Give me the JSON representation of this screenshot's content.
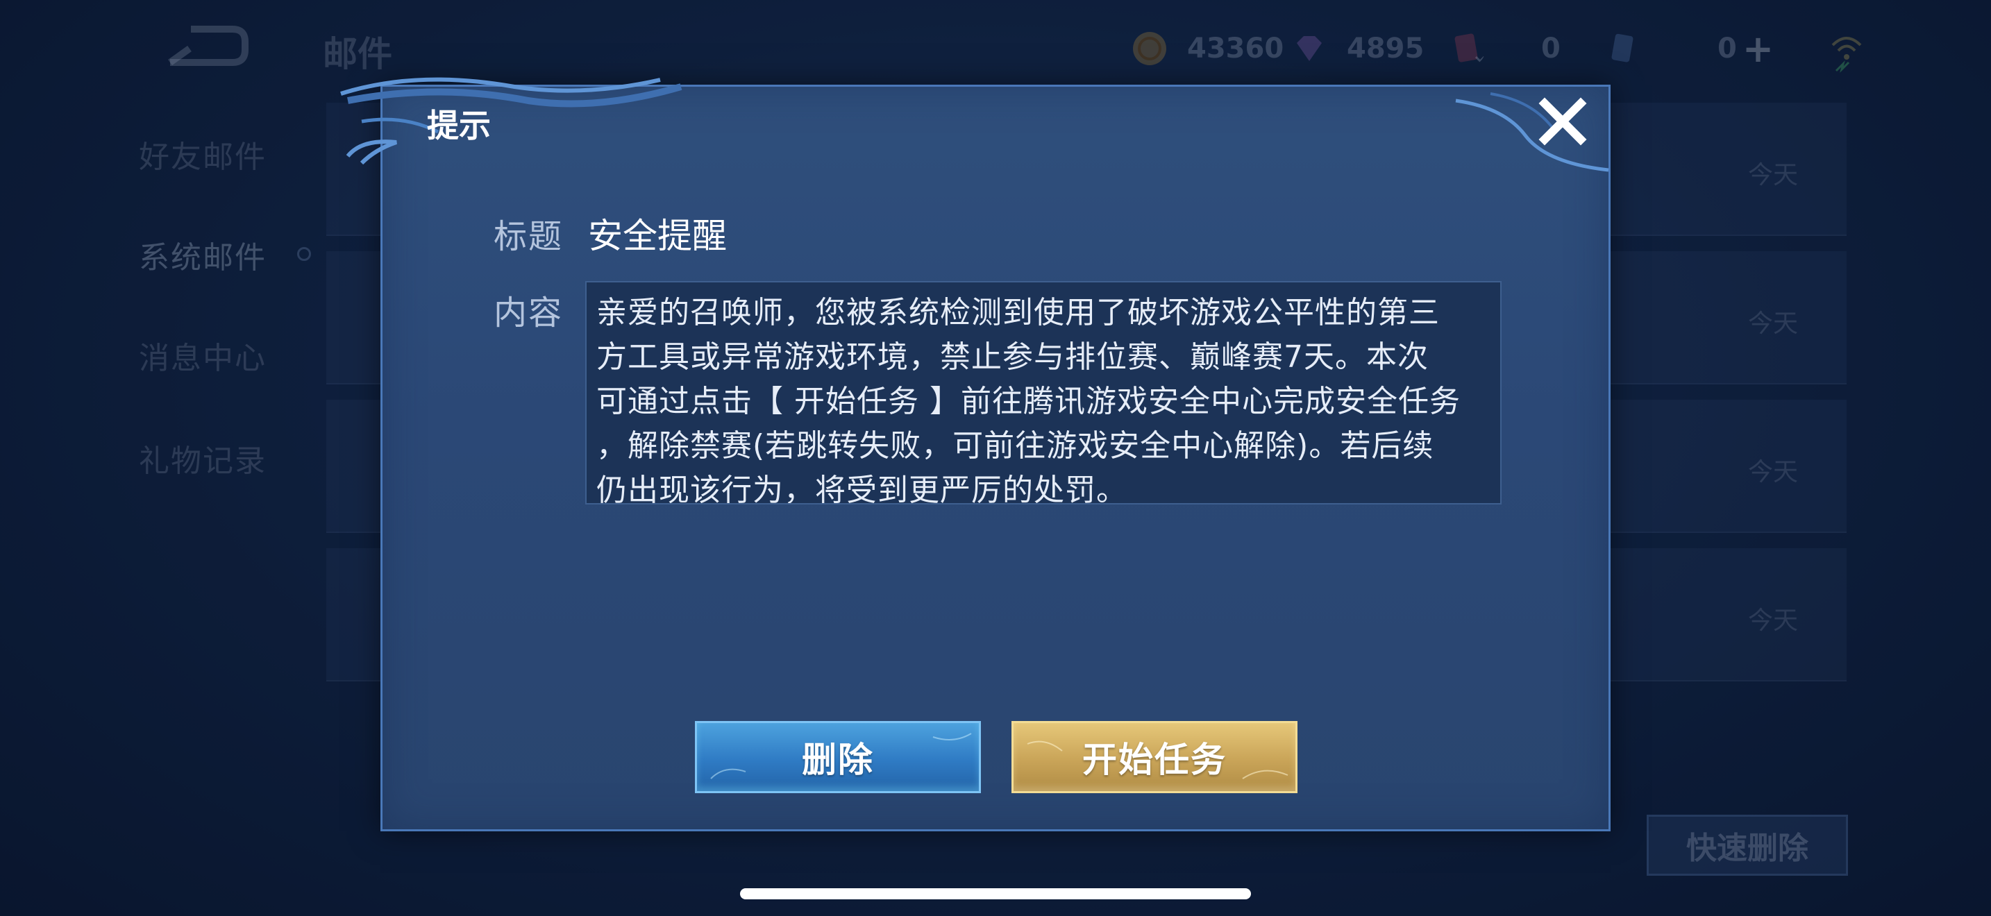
{
  "header": {
    "title": "邮件",
    "currencies": [
      {
        "icon": "gold-coin-icon",
        "value": "43360"
      },
      {
        "icon": "diamond-gem-icon",
        "value": "4895"
      },
      {
        "icon": "ticket-card-icon",
        "value": "0"
      },
      {
        "icon": "point-card-icon",
        "value": "0"
      }
    ],
    "add_icon": "plus-icon",
    "status_icon": "network-status-icon"
  },
  "sidebar": {
    "items": [
      {
        "label": "好友邮件"
      },
      {
        "label": "系统邮件",
        "active": true
      },
      {
        "label": "消息中心"
      },
      {
        "label": "礼物记录"
      }
    ]
  },
  "mail_list": {
    "rows": [
      {
        "date": "今天"
      },
      {
        "date": "今天"
      },
      {
        "date": "今天"
      },
      {
        "date": "今天"
      }
    ],
    "quick_delete_label": "快速删除"
  },
  "dialog": {
    "title": "提示",
    "subject_label": "标题",
    "subject": "安全提醒",
    "content_label": "内容",
    "content": "亲爱的召唤师，您被系统检测到使用了破坏游戏公平性的第三\n方工具或异常游戏环境，禁止参与排位赛、巅峰赛7天。本次\n可通过点击【 开始任务 】前往腾讯游戏安全中心完成安全任务\n，解除禁赛(若跳转失败，可前往游戏安全中心解除)。若后续\n仍出现该行为，将受到更严厉的处罚。",
    "delete_label": "删除",
    "start_label": "开始任务",
    "close_icon": "close-icon"
  },
  "colors": {
    "delete_button": "#2f7bc4",
    "start_button": "#c9a458",
    "dialog_bg": "#2f4f7c",
    "content_bg": "#1c3357"
  }
}
